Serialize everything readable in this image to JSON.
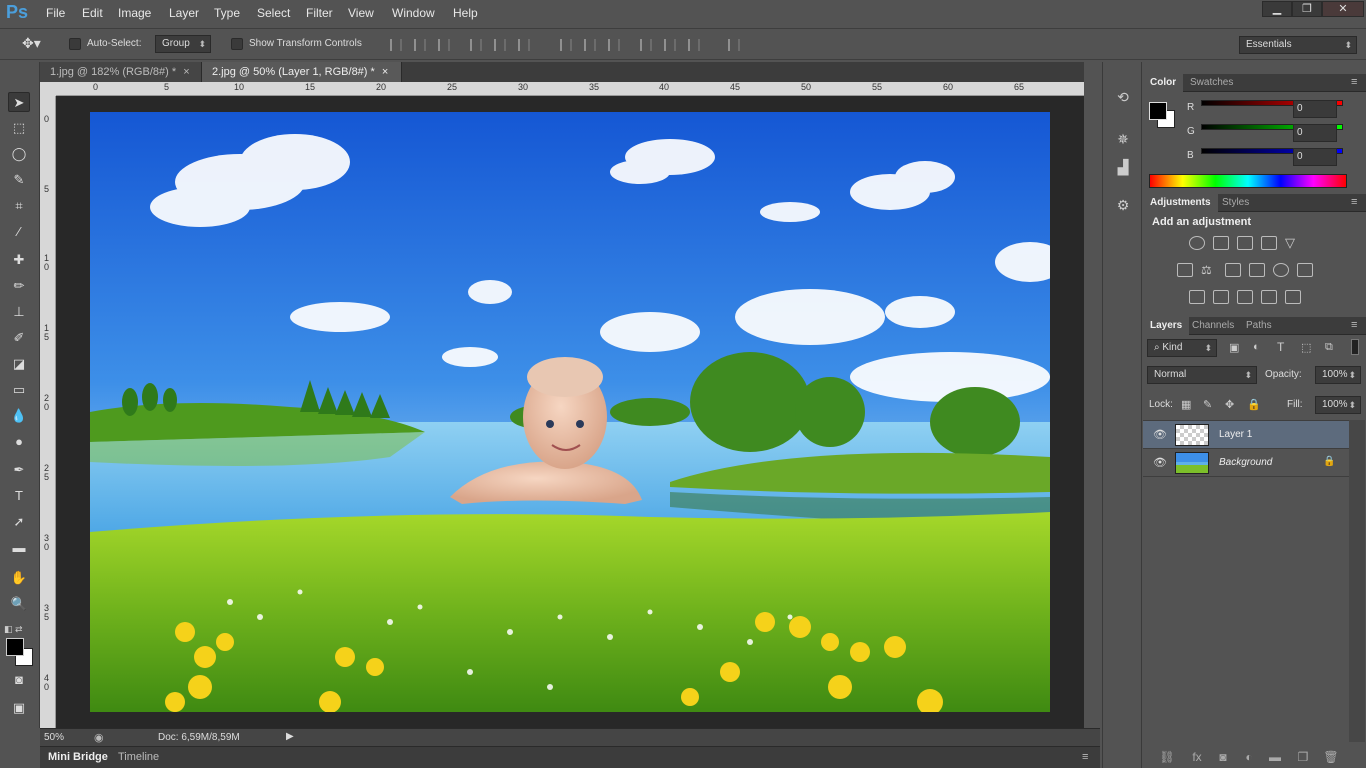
{
  "app": {
    "logo": "Ps"
  },
  "menu": [
    "File",
    "Edit",
    "Image",
    "Layer",
    "Type",
    "Select",
    "Filter",
    "View",
    "Window",
    "Help"
  ],
  "window_controls": [
    "▁",
    "❐",
    "✕"
  ],
  "options_bar": {
    "auto_select_label": "Auto-Select:",
    "auto_select_value": "Group",
    "show_transform_label": "Show Transform Controls",
    "workspace": "Essentials"
  },
  "doc_tabs": [
    {
      "label": "1.jpg @ 182% (RGB/8#) *",
      "active": false
    },
    {
      "label": "2.jpg @ 50% (Layer 1, RGB/8#) *",
      "active": true
    }
  ],
  "ruler_h_ticks": [
    "0",
    "5",
    "10",
    "15",
    "20",
    "25",
    "30",
    "35",
    "40",
    "45",
    "50",
    "55",
    "60",
    "65"
  ],
  "ruler_v_ticks": [
    "0",
    "5",
    "1 0",
    "1 5",
    "2 0",
    "2 5",
    "3 0",
    "3 5",
    "4 0"
  ],
  "status": {
    "zoom": "50%",
    "doc": "Doc: 6,59M/8,59M"
  },
  "bottom_tabs": [
    "Mini Bridge",
    "Timeline"
  ],
  "color_panel": {
    "tabs": [
      "Color",
      "Swatches"
    ],
    "channels": [
      {
        "label": "R",
        "value": "0",
        "color": "#c02020"
      },
      {
        "label": "G",
        "value": "0",
        "color": "#20b020"
      },
      {
        "label": "B",
        "value": "0",
        "color": "#2030d0"
      }
    ]
  },
  "adjustments_panel": {
    "tabs": [
      "Adjustments",
      "Styles"
    ],
    "heading": "Add an adjustment"
  },
  "layers_panel": {
    "tabs": [
      "Layers",
      "Channels",
      "Paths"
    ],
    "filter": "Kind",
    "blend_mode": "Normal",
    "opacity_label": "Opacity:",
    "opacity": "100%",
    "lock_label": "Lock:",
    "fill_label": "Fill:",
    "fill": "100%",
    "layers": [
      {
        "name": "Layer 1",
        "selected": true
      },
      {
        "name": "Background",
        "selected": false
      }
    ]
  },
  "colors": {
    "accent": "#4b9fdc",
    "panel": "#535353",
    "selected_layer": "#5d6b7d"
  }
}
